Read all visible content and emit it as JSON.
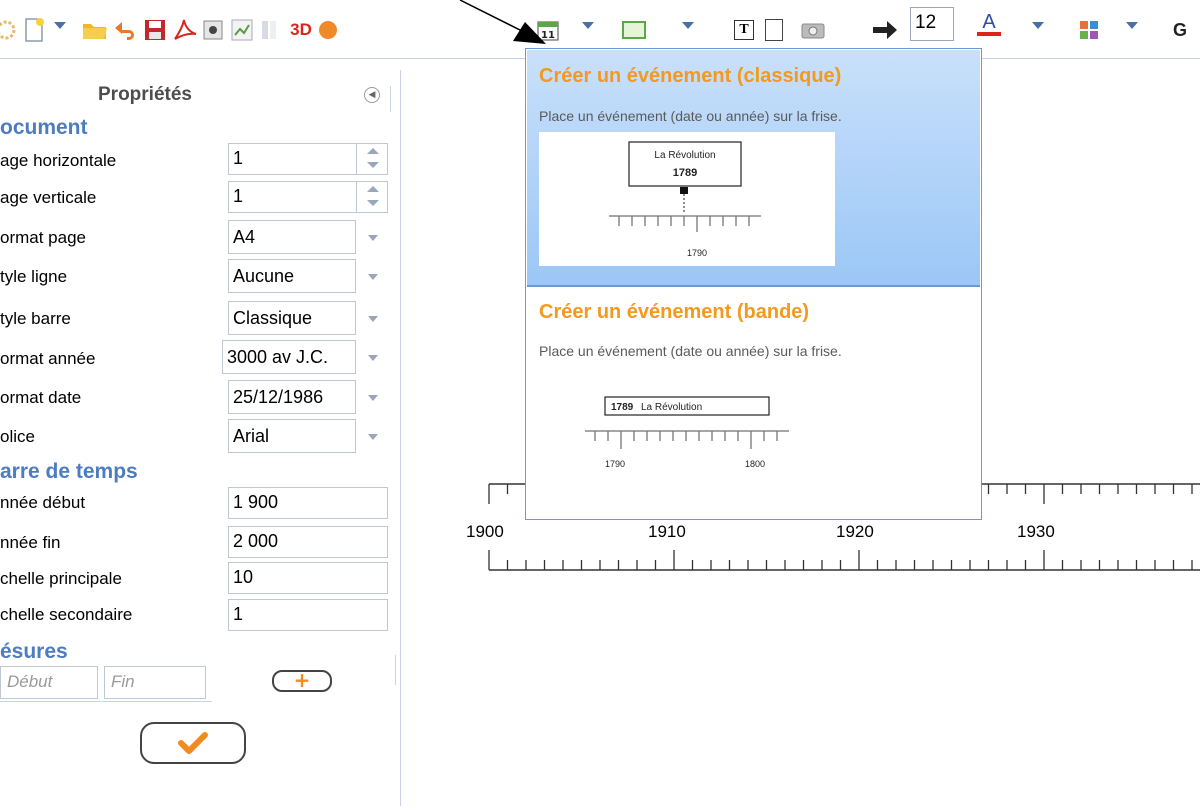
{
  "toolbar": {
    "font_size_value": "12",
    "label_3d": "3D",
    "label_g": "G",
    "calendar_day": "11",
    "text_icon_letter": "T",
    "font_color_letter": "A",
    "colors": {
      "accent": "#4a6fa5",
      "orange": "#f29a1f",
      "red": "#d9251d"
    }
  },
  "panel": {
    "title": "Propriétés",
    "sections": {
      "document": "ocument",
      "barre": "arre de temps",
      "cesures": "ésures"
    },
    "rows": [
      {
        "label": "age horizontale",
        "value": "1"
      },
      {
        "label": "age verticale",
        "value": "1"
      },
      {
        "label": "ormat page",
        "value": "A4"
      },
      {
        "label": "tyle ligne",
        "value": "Aucune"
      },
      {
        "label": "tyle barre",
        "value": "Classique"
      },
      {
        "label": "ormat année",
        "value": "3000 av J.C."
      },
      {
        "label": "ormat date",
        "value": "25/12/1986"
      },
      {
        "label": "olice",
        "value": "Arial"
      },
      {
        "label": "nnée début",
        "value": "1 900"
      },
      {
        "label": "nnée fin",
        "value": "2 000"
      },
      {
        "label": "chelle principale",
        "value": "10"
      },
      {
        "label": "chelle secondaire",
        "value": "1"
      }
    ],
    "cesure_start_placeholder": "Début",
    "cesure_end_placeholder": "Fin",
    "add_label": "+"
  },
  "timeline": {
    "years": [
      "1900",
      "1910",
      "1920",
      "1930"
    ]
  },
  "dropdown": {
    "option1": {
      "title": "Créer un événement (classique)",
      "desc": "Place un événement (date ou année) sur la frise.",
      "preview_event": "La Révolution",
      "preview_year": "1789",
      "preview_axis": "1790"
    },
    "option2": {
      "title": "Créer un événement (bande)",
      "desc": "Place un événement (date ou année) sur la frise.",
      "preview_year": "1789",
      "preview_event": "La Révolution",
      "preview_axis_left": "1790",
      "preview_axis_right": "1800"
    }
  }
}
